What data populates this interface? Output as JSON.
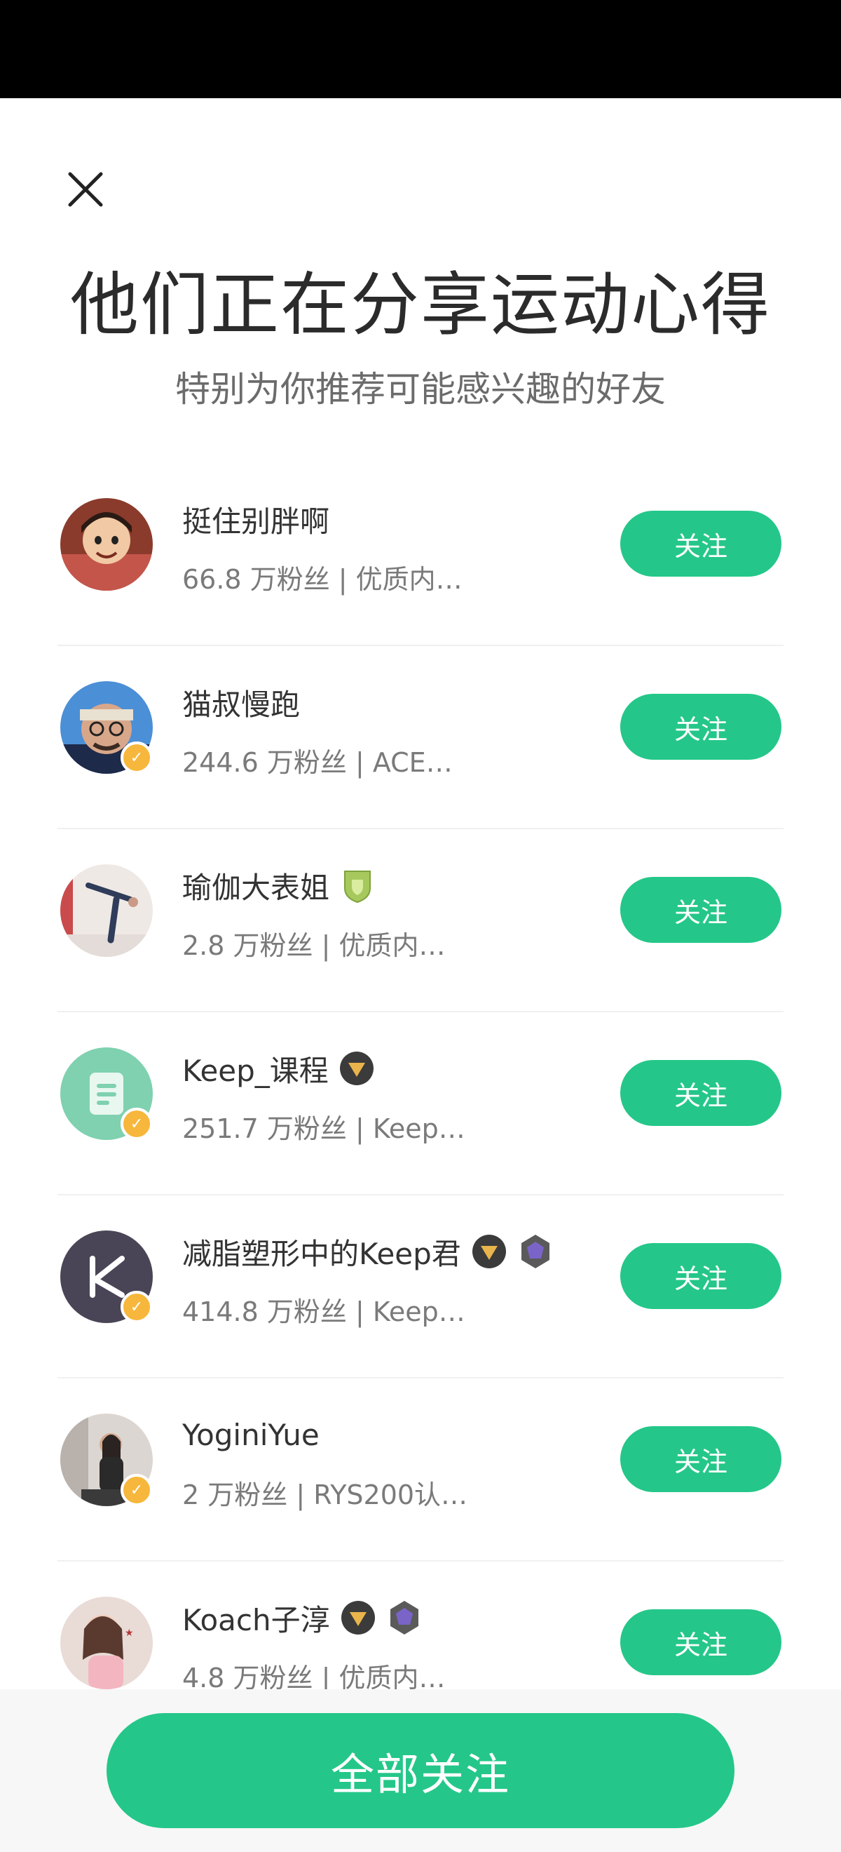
{
  "header": {
    "title": "他们正在分享运动心得",
    "subtitle": "特别为你推荐可能感兴趣的好友"
  },
  "colors": {
    "accent": "#24c789",
    "badge": "#f6b73c"
  },
  "users": [
    {
      "name": "挺住别胖啊",
      "desc": "66.8 万粉丝 | 优质内…",
      "button": "关注"
    },
    {
      "name": "猫叔慢跑",
      "desc": "244.6 万粉丝 | ACE…",
      "button": "关注"
    },
    {
      "name": "瑜伽大表姐",
      "desc": "2.8 万粉丝 | 优质内…",
      "button": "关注"
    },
    {
      "name": "Keep_课程",
      "desc": "251.7 万粉丝 | Keep…",
      "button": "关注"
    },
    {
      "name": "减脂塑形中的Keep君",
      "desc": "414.8 万粉丝 | Keep…",
      "button": "关注"
    },
    {
      "name": "YoginiYue",
      "desc": "2 万粉丝 | RYS200认…",
      "button": "关注"
    },
    {
      "name": "Koach子淳",
      "desc": "4.8 万粉丝 | 优质内…",
      "button": "关注"
    }
  ],
  "footer": {
    "follow_all_label": "全部关注"
  }
}
